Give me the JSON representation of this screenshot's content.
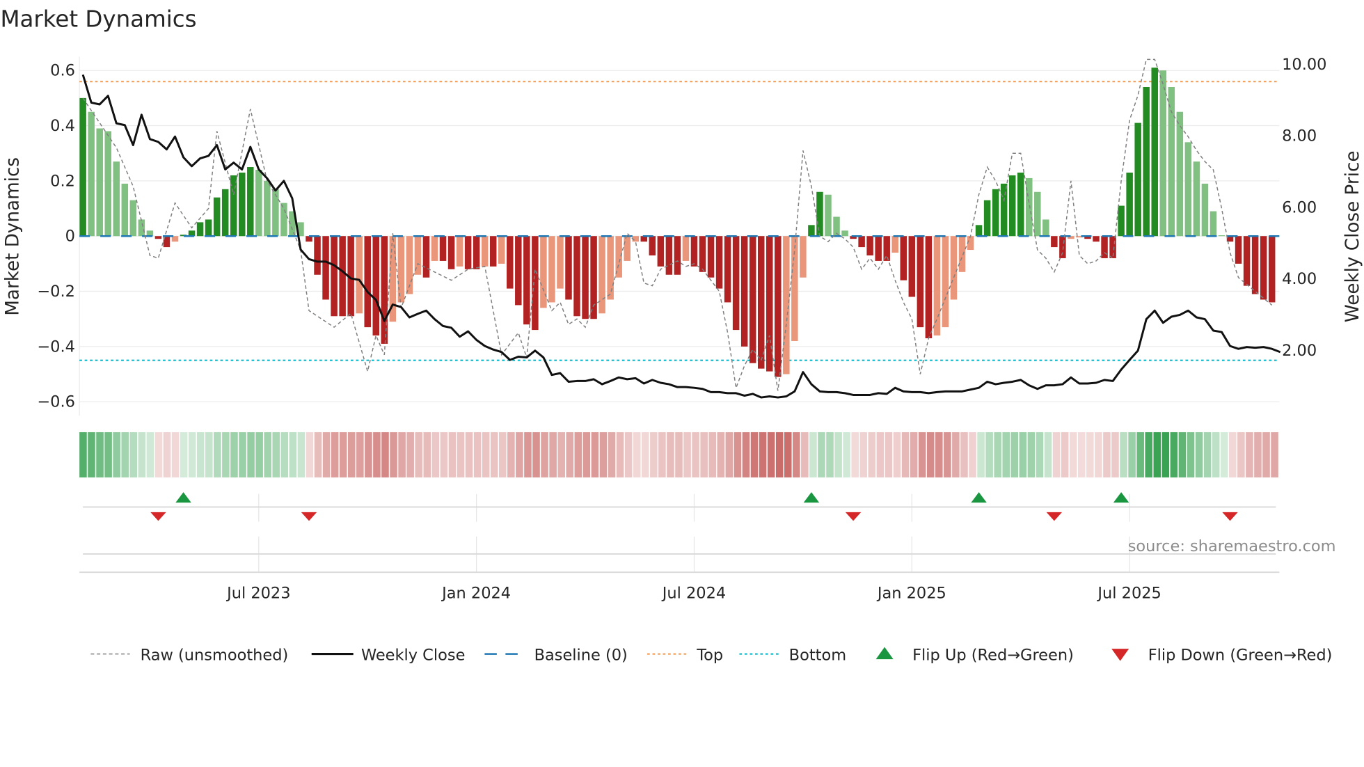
{
  "chart_data": {
    "type": "bar",
    "title": "Market Dynamics",
    "ylabel": "Market Dynamics",
    "ylabel_right": "Weekly Close Price",
    "ylim": [
      -0.65,
      0.65
    ],
    "ylim_right": [
      0.4,
      10.2
    ],
    "yticks": [
      0.6,
      0.4,
      0.2,
      0,
      -0.2,
      -0.4,
      -0.6
    ],
    "ytick_labels": [
      "0.6",
      "0.4",
      "0.2",
      "0",
      "−0.2",
      "−0.4",
      "−0.6"
    ],
    "yticks_right": [
      10,
      8,
      6,
      4,
      2
    ],
    "ytick_labels_right": [
      "10.00",
      "8.00",
      "6.00",
      "4.00",
      "2.00"
    ],
    "x_unit": "week index (weekly bars from Feb 2023 to Oct 2025)",
    "xticks": [
      {
        "week": 21,
        "label": "Jul 2023"
      },
      {
        "week": 47,
        "label": "Jan 2024"
      },
      {
        "week": 73,
        "label": "Jul 2024"
      },
      {
        "week": 99,
        "label": "Jan 2025"
      },
      {
        "week": 125,
        "label": "Jul 2025"
      }
    ],
    "top_level": 0.56,
    "bottom_level": -0.45,
    "baseline": 0,
    "grid": true,
    "bars": [
      0.5,
      0.45,
      0.39,
      0.38,
      0.27,
      0.19,
      0.13,
      0.06,
      0.02,
      -0.01,
      -0.04,
      -0.02,
      0.005,
      0.02,
      0.05,
      0.06,
      0.14,
      0.17,
      0.22,
      0.23,
      0.25,
      0.24,
      0.2,
      0.17,
      0.12,
      0.09,
      0.05,
      -0.02,
      -0.14,
      -0.23,
      -0.29,
      -0.29,
      -0.29,
      -0.28,
      -0.33,
      -0.36,
      -0.39,
      -0.31,
      -0.24,
      -0.21,
      -0.14,
      -0.15,
      -0.09,
      -0.09,
      -0.12,
      -0.11,
      -0.12,
      -0.12,
      -0.11,
      -0.11,
      -0.1,
      -0.19,
      -0.25,
      -0.32,
      -0.34,
      -0.26,
      -0.24,
      -0.19,
      -0.23,
      -0.29,
      -0.3,
      -0.3,
      -0.28,
      -0.23,
      -0.15,
      -0.09,
      -0.02,
      -0.02,
      -0.07,
      -0.11,
      -0.14,
      -0.14,
      -0.09,
      -0.11,
      -0.13,
      -0.15,
      -0.19,
      -0.24,
      -0.34,
      -0.4,
      -0.46,
      -0.48,
      -0.49,
      -0.51,
      -0.5,
      -0.38,
      -0.15,
      0.04,
      0.16,
      0.15,
      0.07,
      0.02,
      -0.01,
      -0.04,
      -0.07,
      -0.09,
      -0.09,
      -0.06,
      -0.16,
      -0.22,
      -0.33,
      -0.37,
      -0.36,
      -0.33,
      -0.23,
      -0.13,
      -0.05,
      0.04,
      0.13,
      0.17,
      0.19,
      0.22,
      0.23,
      0.21,
      0.16,
      0.06,
      -0.04,
      -0.08,
      -0.01,
      -0.005,
      -0.01,
      -0.02,
      -0.08,
      -0.08,
      0.11,
      0.23,
      0.41,
      0.54,
      0.61,
      0.6,
      0.54,
      0.45,
      0.34,
      0.27,
      0.19,
      0.09,
      0.003,
      -0.02,
      -0.1,
      -0.18,
      -0.21,
      -0.23,
      -0.24
    ],
    "weekly_close": [
      9.71,
      8.93,
      8.88,
      9.12,
      8.35,
      8.3,
      7.74,
      8.59,
      7.91,
      7.83,
      7.62,
      7.98,
      7.4,
      7.15,
      7.37,
      7.44,
      7.74,
      7.06,
      7.25,
      7.06,
      7.69,
      7.06,
      6.81,
      6.47,
      6.74,
      6.25,
      4.82,
      4.55,
      4.48,
      4.48,
      4.38,
      4.21,
      4.01,
      3.97,
      3.63,
      3.41,
      2.82,
      3.28,
      3.21,
      2.92,
      3.02,
      3.11,
      2.87,
      2.68,
      2.63,
      2.38,
      2.53,
      2.29,
      2.12,
      2.02,
      1.95,
      1.73,
      1.82,
      1.8,
      1.99,
      1.8,
      1.31,
      1.36,
      1.12,
      1.14,
      1.14,
      1.19,
      1.05,
      1.14,
      1.24,
      1.19,
      1.22,
      1.07,
      1.17,
      1.09,
      1.05,
      0.97,
      0.97,
      0.95,
      0.92,
      0.83,
      0.83,
      0.8,
      0.8,
      0.73,
      0.78,
      0.68,
      0.71,
      0.68,
      0.71,
      0.85,
      1.39,
      1.05,
      0.85,
      0.83,
      0.83,
      0.8,
      0.75,
      0.75,
      0.75,
      0.8,
      0.78,
      0.95,
      0.85,
      0.83,
      0.83,
      0.8,
      0.83,
      0.85,
      0.85,
      0.85,
      0.9,
      0.95,
      1.12,
      1.05,
      1.09,
      1.12,
      1.17,
      1.02,
      0.92,
      1.02,
      1.02,
      1.05,
      1.24,
      1.07,
      1.07,
      1.09,
      1.17,
      1.14,
      1.46,
      1.73,
      1.99,
      2.87,
      3.11,
      2.77,
      2.94,
      2.99,
      3.11,
      2.92,
      2.87,
      2.55,
      2.51,
      2.12,
      2.04,
      2.09,
      2.07,
      2.09,
      2.04,
      1.95
    ],
    "raw": [
      [
        0,
        0.5
      ],
      [
        4,
        0.32
      ],
      [
        6,
        0.18
      ],
      [
        8,
        -0.07
      ],
      [
        9,
        -0.08
      ],
      [
        11,
        0.12
      ],
      [
        13,
        0.03
      ],
      [
        15,
        0.1
      ],
      [
        16,
        0.38
      ],
      [
        18,
        0.15
      ],
      [
        20,
        0.46
      ],
      [
        22,
        0.2
      ],
      [
        24,
        0.1
      ],
      [
        26,
        -0.05
      ],
      [
        27,
        -0.27
      ],
      [
        28,
        -0.29
      ],
      [
        30,
        -0.33
      ],
      [
        32,
        -0.28
      ],
      [
        34,
        -0.49
      ],
      [
        35,
        -0.36
      ],
      [
        36,
        -0.43
      ],
      [
        37,
        0.01
      ],
      [
        38,
        -0.26
      ],
      [
        40,
        -0.1
      ],
      [
        42,
        -0.13
      ],
      [
        44,
        -0.16
      ],
      [
        46,
        -0.12
      ],
      [
        48,
        -0.11
      ],
      [
        50,
        -0.43
      ],
      [
        52,
        -0.35
      ],
      [
        53,
        -0.44
      ],
      [
        54,
        -0.12
      ],
      [
        56,
        -0.27
      ],
      [
        57,
        -0.24
      ],
      [
        58,
        -0.32
      ],
      [
        59,
        -0.3
      ],
      [
        60,
        -0.33
      ],
      [
        61,
        -0.25
      ],
      [
        63,
        -0.21
      ],
      [
        65,
        0.01
      ],
      [
        66,
        -0.02
      ],
      [
        67,
        -0.17
      ],
      [
        68,
        -0.18
      ],
      [
        69,
        -0.12
      ],
      [
        71,
        -0.09
      ],
      [
        72,
        -0.11
      ],
      [
        73,
        -0.1
      ],
      [
        74,
        -0.12
      ],
      [
        76,
        -0.2
      ],
      [
        77,
        -0.35
      ],
      [
        78,
        -0.55
      ],
      [
        79,
        -0.47
      ],
      [
        80,
        -0.41
      ],
      [
        81,
        -0.45
      ],
      [
        82,
        -0.36
      ],
      [
        83,
        -0.56
      ],
      [
        84,
        -0.32
      ],
      [
        85,
        -0.05
      ],
      [
        86,
        0.31
      ],
      [
        87,
        0.18
      ],
      [
        88,
        0.0
      ],
      [
        89,
        -0.02
      ],
      [
        90,
        0.01
      ],
      [
        91,
        -0.01
      ],
      [
        92,
        -0.04
      ],
      [
        93,
        -0.12
      ],
      [
        94,
        -0.08
      ],
      [
        95,
        -0.12
      ],
      [
        96,
        -0.07
      ],
      [
        97,
        -0.16
      ],
      [
        98,
        -0.24
      ],
      [
        99,
        -0.3
      ],
      [
        100,
        -0.5
      ],
      [
        101,
        -0.37
      ],
      [
        102,
        -0.3
      ],
      [
        104,
        -0.15
      ],
      [
        106,
        0.0
      ],
      [
        107,
        0.15
      ],
      [
        108,
        0.25
      ],
      [
        109,
        0.2
      ],
      [
        110,
        0.13
      ],
      [
        111,
        0.3
      ],
      [
        112,
        0.3
      ],
      [
        113,
        0.12
      ],
      [
        114,
        -0.05
      ],
      [
        115,
        -0.08
      ],
      [
        116,
        -0.13
      ],
      [
        117,
        -0.06
      ],
      [
        118,
        0.2
      ],
      [
        119,
        -0.07
      ],
      [
        120,
        -0.1
      ],
      [
        121,
        -0.09
      ],
      [
        122,
        -0.06
      ],
      [
        123,
        -0.08
      ],
      [
        124,
        0.2
      ],
      [
        125,
        0.42
      ],
      [
        126,
        0.51
      ],
      [
        127,
        0.64
      ],
      [
        128,
        0.64
      ],
      [
        129,
        0.55
      ],
      [
        130,
        0.45
      ],
      [
        131,
        0.4
      ],
      [
        132,
        0.36
      ],
      [
        133,
        0.31
      ],
      [
        134,
        0.27
      ],
      [
        135,
        0.24
      ],
      [
        136,
        0.1
      ],
      [
        137,
        -0.06
      ],
      [
        138,
        -0.15
      ],
      [
        140,
        -0.2
      ],
      [
        142,
        -0.25
      ]
    ],
    "flip_up_weeks": [
      12,
      87,
      107,
      124
    ],
    "flip_down_weeks": [
      9,
      27,
      92,
      116,
      137
    ],
    "legend_placement": "bottom",
    "legend": [
      "Raw (unsmoothed)",
      "Weekly Close",
      "Baseline (0)",
      "Top",
      "Bottom",
      "Flip Up (Red→Green)",
      "Flip Down (Green→Red)"
    ],
    "source": "source: sharemaestro.com",
    "colors": {
      "green_dark": "#228b22",
      "green_light": "#80c080",
      "red_dark": "#b22222",
      "red_light": "#e9967a",
      "close": "#111111",
      "raw": "#808080",
      "baseline": "#1f77b4",
      "top": "#f4a460",
      "bottom": "#17becf",
      "flip_up": "#1a9641",
      "flip_down": "#d62728"
    }
  }
}
